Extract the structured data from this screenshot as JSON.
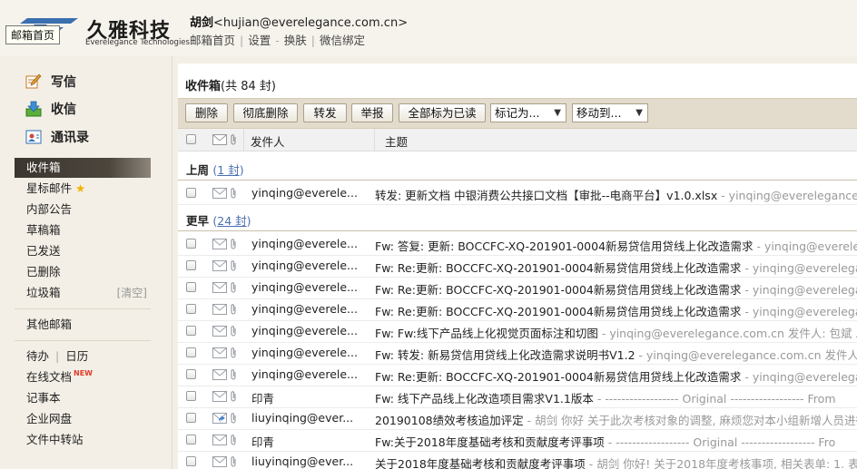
{
  "header": {
    "logo_cn": "久雅科技",
    "logo_en": "Everelegance Technologies",
    "tooltip": "邮箱首页",
    "user_name": "胡剑",
    "user_email": "<hujian@everelegance.com.cn>",
    "links": [
      "邮箱首页",
      "设置",
      "换肤",
      "微信绑定"
    ],
    "brand_color": "#3a6fb0"
  },
  "sidebar": {
    "compose": {
      "label": "写信",
      "icon": "pencil-note-icon"
    },
    "receive": {
      "label": "收信",
      "icon": "inbox-download-icon"
    },
    "contacts": {
      "label": "通讯录",
      "icon": "address-book-icon"
    },
    "folders": [
      {
        "label": "收件箱",
        "active": true
      },
      {
        "label": "星标邮件",
        "icon": "star-icon"
      },
      {
        "label": "内部公告"
      },
      {
        "label": "草稿箱"
      },
      {
        "label": "已发送"
      },
      {
        "label": "已删除"
      },
      {
        "label": "垃圾箱",
        "action": "[清空]"
      }
    ],
    "other": "其他邮箱",
    "tools": {
      "todo": "待办",
      "calendar": "日历",
      "online_docs": "在线文档",
      "online_docs_badge": "NEW",
      "notes": "记事本",
      "netdisk": "企业网盘",
      "transfer": "文件中转站"
    }
  },
  "main": {
    "title": "收件箱",
    "title_count": "(共 84 封)",
    "toolbar": {
      "delete": "删除",
      "delete_forever": "彻底删除",
      "forward": "转发",
      "report": "举报",
      "mark_all_read": "全部标为已读",
      "mark_as": "标记为...",
      "move_to": "移动到..."
    },
    "columns": {
      "sender": "发件人",
      "subject": "主题"
    },
    "groups": [
      {
        "label": "上周",
        "count": "1 封",
        "rows": [
          {
            "sender": "yinqing@everele...",
            "subject": "转发: 更新文档 中银消费公共接口文档【审批--电商平台】v1.0.xlsx",
            "preview": " - yinqing@everelegance.c",
            "icon": "envelope-icon"
          }
        ]
      },
      {
        "label": "更早",
        "count": "24 封",
        "rows": [
          {
            "sender": "yinqing@everele...",
            "subject": "Fw: 答复: 更新: BOCCFC-XQ-201901-0004新易贷信用贷线上化改造需求",
            "preview": " - yinqing@everelega",
            "icon": "envelope-icon"
          },
          {
            "sender": "yinqing@everele...",
            "subject": "Fw: Re:更新: BOCCFC-XQ-201901-0004新易贷信用贷线上化改造需求",
            "preview": " - yinqing@everelegar",
            "icon": "envelope-icon"
          },
          {
            "sender": "yinqing@everele...",
            "subject": "Fw: Re:更新: BOCCFC-XQ-201901-0004新易贷信用贷线上化改造需求",
            "preview": " - yinqing@everelegar",
            "icon": "envelope-icon"
          },
          {
            "sender": "yinqing@everele...",
            "subject": "Fw: Re:更新: BOCCFC-XQ-201901-0004新易贷信用贷线上化改造需求",
            "preview": " - yinqing@everelegar",
            "icon": "envelope-icon"
          },
          {
            "sender": "yinqing@everele...",
            "subject": "Fw: Fw:线下产品线上化视觉页面标注和切图",
            "preview": " - yinqing@everelegance.com.cn 发件人: 包斌 发",
            "icon": "envelope-icon"
          },
          {
            "sender": "yinqing@everele...",
            "subject": "Fw: 转发: 新易贷信用贷线上化改造需求说明书V1.2",
            "preview": " - yinqing@everelegance.com.cn 发件人: ",
            "icon": "envelope-icon"
          },
          {
            "sender": "yinqing@everele...",
            "subject": "Fw: Re:更新: BOCCFC-XQ-201901-0004新易贷信用贷线上化改造需求",
            "preview": " - yinqing@everelegar",
            "icon": "envelope-icon"
          },
          {
            "sender": "印青",
            "subject": "Fw: 线下产品线上化改造项目需求V1.1版本",
            "preview": " - ------------------ Original ------------------ From",
            "icon": "envelope-icon"
          },
          {
            "sender": "liuyinqing@ever...",
            "subject": "20190108绩效考核追加评定",
            "preview": " - 胡剑 你好 关于此次考核对象的调整, 麻烦您对本小组新增人员进行",
            "icon": "reply-envelope-icon"
          },
          {
            "sender": "印青",
            "subject": "Fw:关于2018年度基础考核和贡献度考评事项",
            "preview": " - ------------------ Original ------------------ Fro",
            "icon": "envelope-icon"
          },
          {
            "sender": "liuyinqing@ever...",
            "subject": "关于2018年度基础考核和贡献度考评事项",
            "preview": " - 胡剑 你好!  关于2018年度考核事项, 相关表单: 1. 表",
            "icon": "envelope-icon"
          }
        ]
      }
    ]
  }
}
